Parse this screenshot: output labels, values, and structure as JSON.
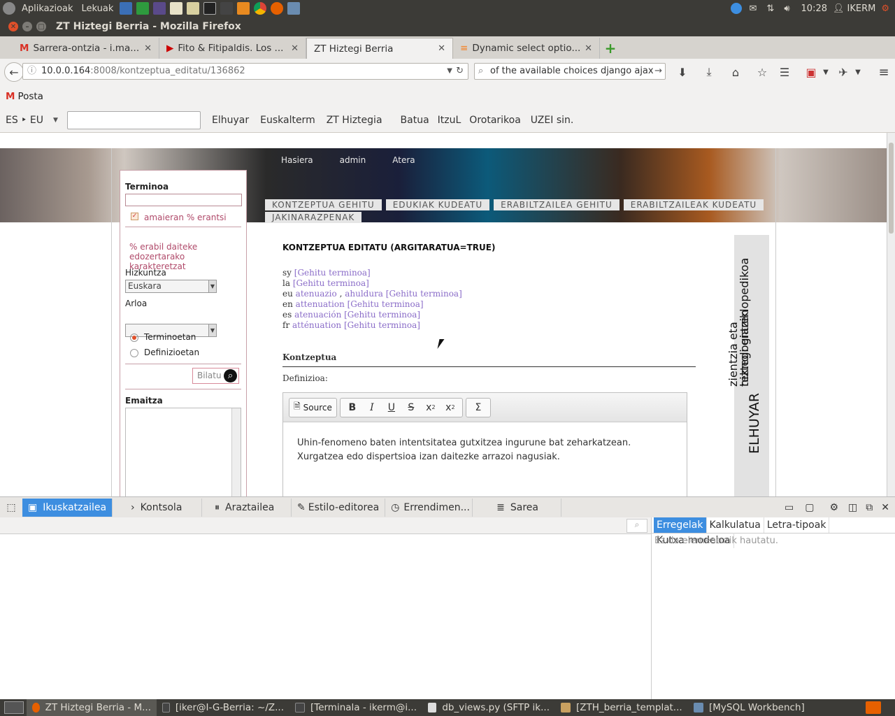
{
  "system": {
    "menu_apps": "Aplikazioak",
    "menu_places": "Lekuak",
    "time": "10:28",
    "user": "IKERM"
  },
  "window": {
    "title": "ZT Hiztegi Berria - Mozilla Firefox"
  },
  "tabs": [
    {
      "label": "Sarrera-ontzia - i.ma...",
      "color": "#d93025"
    },
    {
      "label": "Fito & Fitipaldis. Los ...",
      "color": "#cc0000"
    },
    {
      "label": "ZT Hiztegi Berria",
      "color": ""
    },
    {
      "label": "Dynamic select optio...",
      "color": "#f48024"
    }
  ],
  "nav": {
    "url_host": "10.0.0.164",
    "url_rest": ":8008/kontzeptua_editatu/136862",
    "search_value": "of the available choices django ajax"
  },
  "bookmarks": {
    "posta": "Posta"
  },
  "langbar": {
    "pair": "ES ‣ EU",
    "links": [
      "Elhuyar",
      "Euskalterm",
      "ZT Hiztegia",
      "Batua",
      "ItzuL",
      "Orotarikoa",
      "UZEI sin."
    ]
  },
  "sidebar": {
    "terminoa_label": "Terminoa",
    "amaieran_label": "amaieran % erantsi",
    "hint": "% erabil daiteke edozertarako karakteretzat",
    "hizkuntza_label": "Hizkuntza",
    "hizkuntza_value": "Euskara",
    "arloa_label": "Arloa",
    "radio_terms": "Terminoetan",
    "radio_defs": "Definizioetan",
    "search_button": "Bilatu",
    "emaitza_label": "Emaitza"
  },
  "topnav": [
    "Hasiera",
    "admin",
    "Atera"
  ],
  "menu_tabs": [
    "KONTZEPTUA GEHITU",
    "EDUKIAK KUDEATU",
    "ERABILTZAILEA GEHITU",
    "ERABILTZAILEAK KUDEATU",
    "JAKINARAZPENAK"
  ],
  "page": {
    "heading": "KONTZEPTUA EDITATU (ARGITARATUA=TRUE)",
    "add_term": "[Gehitu terminoa]",
    "terms": [
      {
        "lang": "sy",
        "words": []
      },
      {
        "lang": "la",
        "words": []
      },
      {
        "lang": "eu",
        "words": [
          "atenuazio",
          "ahuldura"
        ]
      },
      {
        "lang": "en",
        "words": [
          "attenuation"
        ]
      },
      {
        "lang": "es",
        "words": [
          "atenuación"
        ]
      },
      {
        "lang": "fr",
        "words": [
          "atténuation"
        ]
      }
    ],
    "section_title": "Kontzeptua",
    "definition_label": "Definizioa:",
    "definition_line1": "Uhin-fenomeno baten intentsitatea gutxitzea ingurune bat zeharkatzean.",
    "definition_line2": "Xurgatzea edo dispertsioa izan daitezke arrazoi nagusiak.",
    "source_button": "Source"
  },
  "side_logo": {
    "line1": "ELHUYAR",
    "line2": "zientzia eta teknologiaren",
    "line3": "hiztegi entziklopedikoa"
  },
  "devtools": {
    "tabs": [
      "Ikuskatzailea",
      "Kontsola",
      "Araztailea",
      "Estilo-editorea",
      "Errendimen...",
      "Sarea"
    ],
    "right_tabs": [
      "Erregelak",
      "Kalkulatua",
      "Letra-tipoak",
      "Kutxa-modeloa"
    ],
    "empty_message": "Ez da elementurik hautatu."
  },
  "taskbar": [
    {
      "label": "ZT Hiztegi Berria - M...",
      "color": "#e66000"
    },
    {
      "label": "[iker@I-G-Berria: ~/Z...",
      "color": "#444"
    },
    {
      "label": "[Terminala - ikerm@i...",
      "color": "#444"
    },
    {
      "label": "db_views.py (SFTP ik...",
      "color": "#ddd"
    },
    {
      "label": "[ZTH_berria_templat...",
      "color": "#c8a060"
    },
    {
      "label": "[MySQL Workbench]",
      "color": "#6a8cb0"
    }
  ]
}
